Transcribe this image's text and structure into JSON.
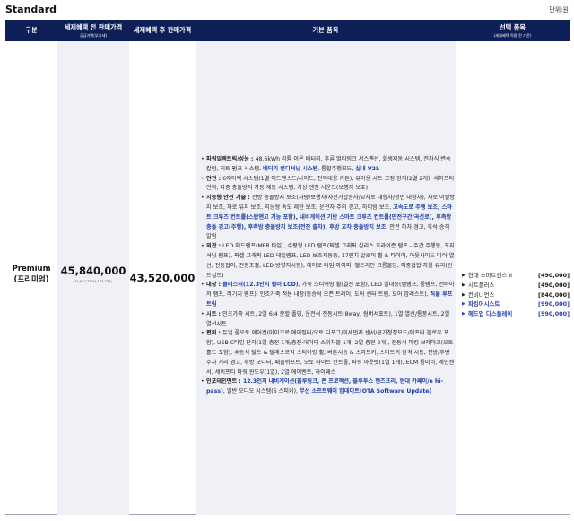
{
  "page": {
    "title": "Standard",
    "unit": "단위:원"
  },
  "header": {
    "col_trim": "구분",
    "col_before": "세제혜택 전 판매가격",
    "col_before_sub": "공급가액(부가세)",
    "col_after": "세제혜택 후 판매가격",
    "col_features": "기본 품목",
    "col_options": "선택 품목",
    "col_options_sub": "(세제혜택 적용 전 기준)"
  },
  "trim": {
    "name": "Premium",
    "name_ko": "(프리미엄)",
    "price_before": "45,840,000",
    "price_before_sub": "41,672,727(4,167,273)",
    "price_after": "43,520,000"
  },
  "features": [
    {
      "head": "파워일렉트릭/성능 : ",
      "parts": [
        {
          "t": "48.6kWh 리튬 이온 배터리, 후륜 멀티링크 서스펜션, 회생제동 시스템, 전자식 변속 칼럼, 히트 펌프 시스템, ",
          "h": false
        },
        {
          "t": "배터리 컨디셔닝 시스템",
          "h": true
        },
        {
          "t": ", 통합주행모드, ",
          "h": false
        },
        {
          "t": "실내 V2L",
          "h": true
        }
      ]
    },
    {
      "head": "안전 : ",
      "parts": [
        {
          "t": "6에어백 시스템(1열 어드밴스드/사이드, 전복대응 커튼), 유아용 시트 고정 장치(2열 2개), 세이프티 언락, 다중 충돌방지 자동 제동 시스템, 가상 엔진 사운드(보행자 보호)",
          "h": false
        }
      ]
    },
    {
      "head": "지능형 안전 기술 : ",
      "parts": [
        {
          "t": "전방 충돌방지 보조(차량/보행자/자전거탑승자/교차로 대향차/정면 대향차), 차로 이탈방지 보조, 차로 유지 보조, 지능형 속도 제한 보조, 운전자 주의 경고, 하이빔 보조, ",
          "h": false
        },
        {
          "t": "고속도로 주행 보조, 스마트 크루즈 컨트롤(스탑앤고 기능 포함), 내비게이션 기반 스마트 크루즈 컨트롤(안전구간/곡선로), 후측방 충돌 경고(주행), 후측방 충돌방지 보조(전진 출차), 후방 교차 충돌방지 보조",
          "h": true
        },
        {
          "t": ", 안전 하차 경고, 후석 승객 알림",
          "h": false
        }
      ]
    },
    {
      "head": "외관 : ",
      "parts": [
        {
          "t": "LED 헤드램프(MFR 타입), 수평형 LED 램프(픽셀 그래픽 심리스 호라이즌 램프 - 주간 주행등, 포지셔닝 램프), 픽셀 그래픽 LED 테일램프, LED 보조제동등, 17인치 알로이 휠 & 타이어, 아웃사이드 미러(열선, 전동접이, 전동조절, LED 방향지시등), 에어로 타입 와이퍼, 벨트라인 크롬몰딩, 이중접합 차음 유리(윈드실드)",
          "h": false
        }
      ]
    },
    {
      "head": "내장 : ",
      "parts": [
        {
          "t": "클러스터(12.3인치 컬러 LCD)",
          "h": true
        },
        {
          "t": ", 가죽 스티어링 휠(열선 포함), LED 실내등(맵램프, 룸램프, 선바이저 램프, 러기지 램프), 인조가죽 적용 내장(동승석 오픈 트레이, 도어 센터 트림, 도어 암레스트), ",
          "h": false
        },
        {
          "t": "직물 루프 트림",
          "h": true
        }
      ]
    },
    {
      "head": "시트 : ",
      "parts": [
        {
          "t": "인조가죽 시트, 2열 6:4 분할 폴딩, 운전석 전동시트(8way, 럼버서포트), 1열 열선/통풍시트, 2열 열선시트",
          "h": false
        }
      ]
    },
    {
      "head": "편의 : ",
      "parts": [
        {
          "t": "듀얼 풀오토 에어컨(마이크로 에어필터/오토 디포그/미세먼지 센서/공기청정모드/애프터 블로우 포함), USB C타입 단자(1열 충전 1개/충전·데이터 스위처블 1개, 2열 충전 2개), 전동식 파킹 브레이크(오토홀드 포함), 수동식 틸트 & 텔레스코픽 스티어링 휠, 버튼시동 & 스마트키, 스마트키 원격 시동, 전방/후방 주차 거리 경고, 후방 모니터, 패들쉬프트, 오토 라이트 컨트롤, 파워 아웃렛(1열 1개), ECM 룸미러, 레인센서, 세이프티 파워 윈도우(1열), 2열 에어벤트, 하이패스",
          "h": false
        }
      ]
    },
    {
      "head": "인포테인먼트 : ",
      "parts": [
        {
          "t": "12.3인치 내비게이션(블루링크, 폰 프로젝션, 블루투스 핸즈프리, 현대 카페이/e hi-pass)",
          "h": true
        },
        {
          "t": ", 일반 오디오 시스템(6 스피커), ",
          "h": false
        },
        {
          "t": "무선 소프트웨어 업데이트(OTA Software Update)",
          "h": true
        }
      ]
    }
  ],
  "options": [
    {
      "name": "현대 스마트센스 II",
      "price": "[490,000]",
      "accent": false
    },
    {
      "name": "시트플러스",
      "price": "[490,000]",
      "accent": false
    },
    {
      "name": "컨비니언스",
      "price": "[840,000]",
      "accent": false
    },
    {
      "name": "파킹어시스트",
      "price": "[990,000]",
      "accent": true
    },
    {
      "name": "헤드업 디스플레이",
      "price": "[590,000]",
      "accent": true
    }
  ],
  "colors": {
    "header_bg": "#0e1e57",
    "highlight_text": "#1e3fa3",
    "accent_option": "#2b44b8"
  }
}
